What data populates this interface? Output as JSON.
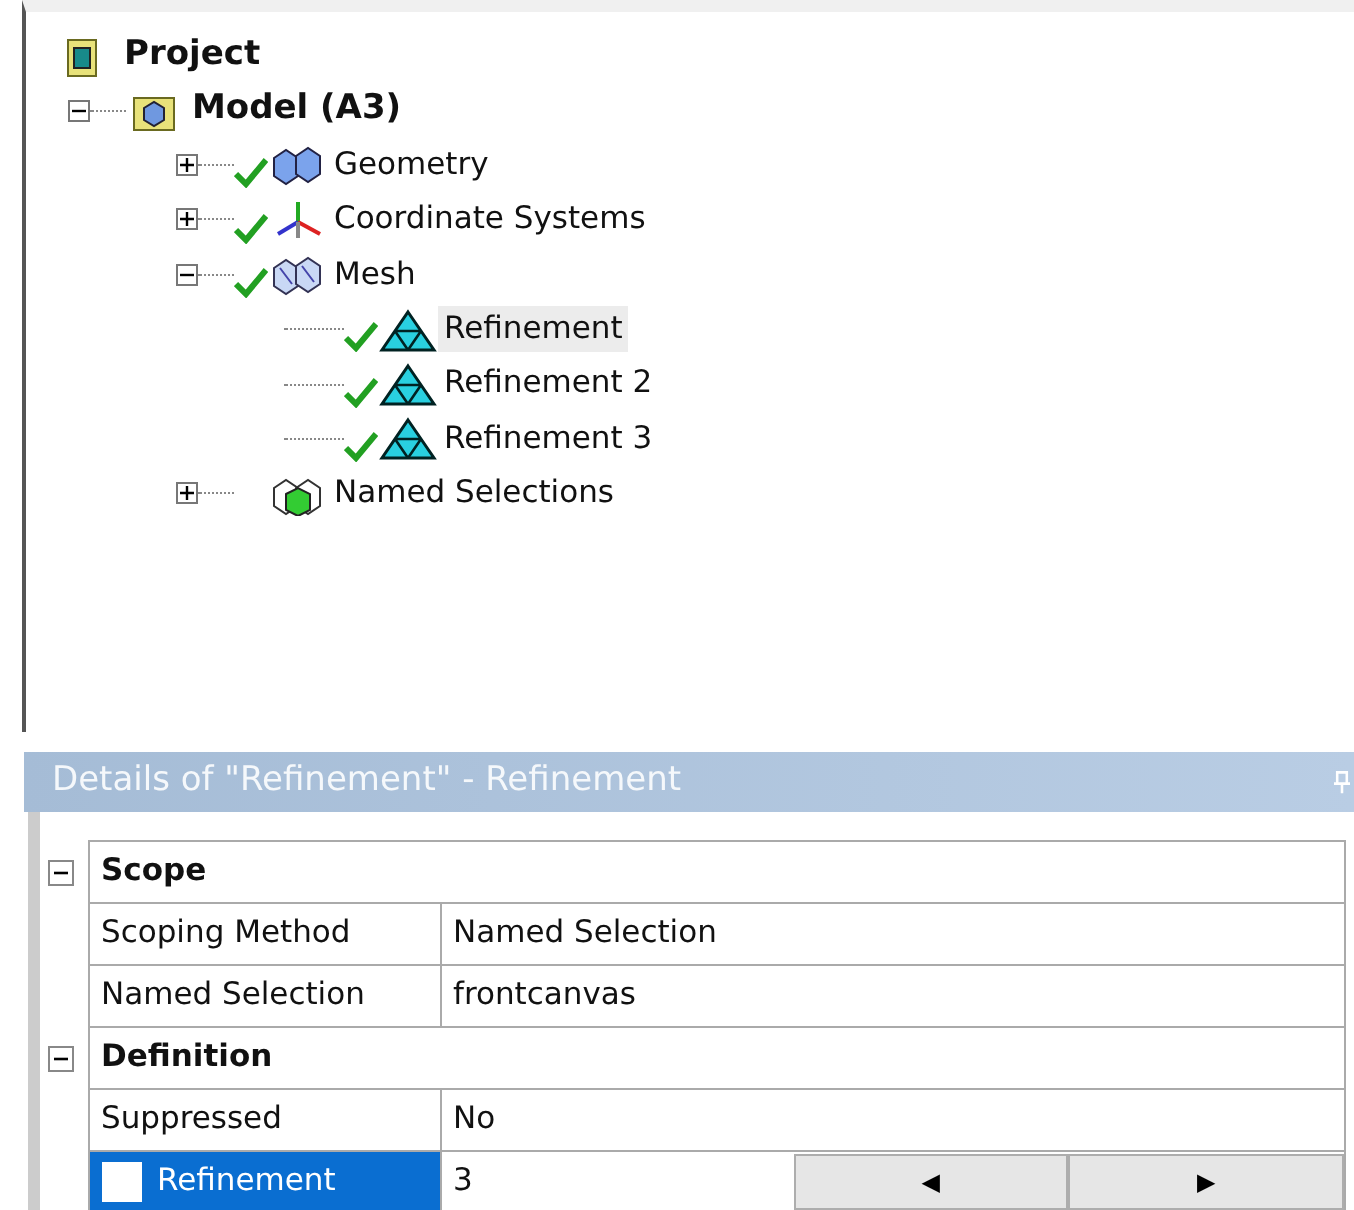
{
  "tree": [
    {
      "label": "Project",
      "kind": "project",
      "children": [
        {
          "label": "Model (A3)",
          "kind": "model",
          "expanded": true,
          "children": [
            {
              "label": "Geometry",
              "kind": "geometry",
              "checked": true,
              "expanded": false
            },
            {
              "label": "Coordinate Systems",
              "kind": "coordinates",
              "checked": true,
              "expanded": false
            },
            {
              "label": "Mesh",
              "kind": "mesh",
              "checked": true,
              "expanded": true,
              "children": [
                {
                  "label": "Refinement",
                  "kind": "refinement",
                  "checked": true,
                  "selected": true
                },
                {
                  "label": "Refinement 2",
                  "kind": "refinement",
                  "checked": true,
                  "selected": false
                },
                {
                  "label": "Refinement 3",
                  "kind": "refinement",
                  "checked": true,
                  "selected": false
                }
              ]
            },
            {
              "label": "Named Selections",
              "kind": "named_selections",
              "checked": false,
              "expanded": false
            }
          ]
        }
      ]
    }
  ],
  "details": {
    "title": "Details of \"Refinement\" - Refinement",
    "groups": [
      {
        "label": "Scope",
        "expanded": true,
        "rows": [
          {
            "label": "Scoping Method",
            "value": "Named Selection",
            "selected": false
          },
          {
            "label": "Named Selection",
            "value": "frontcanvas",
            "selected": false
          }
        ]
      },
      {
        "label": "Definition",
        "expanded": true,
        "rows": [
          {
            "label": "Suppressed",
            "value": "No",
            "selected": false
          },
          {
            "label": "Refinement",
            "value": "3",
            "selected": true,
            "checked": false,
            "buttons": [
              "◀",
              "▶"
            ]
          }
        ]
      }
    ]
  }
}
